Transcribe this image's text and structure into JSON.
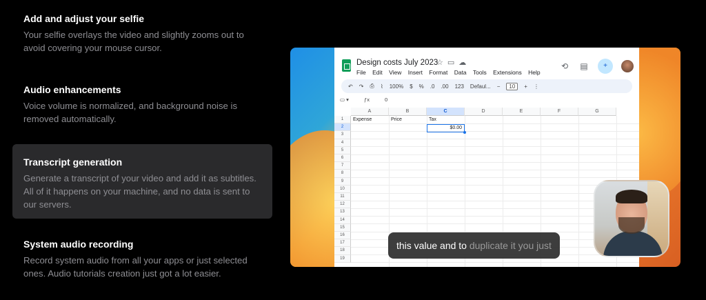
{
  "features": [
    {
      "title": "Add and adjust your selfie",
      "description": "Your selfie overlays the video and slightly zooms out to avoid covering your mouse cursor."
    },
    {
      "title": "Audio enhancements",
      "description": "Voice volume is normalized, and background noise is removed automatically."
    },
    {
      "title": "Transcript generation",
      "description": "Generate a transcript of your video and add it as subtitles. All of it happens on your machine, and no data is sent to our servers."
    },
    {
      "title": "System audio recording",
      "description": "Record system audio from all your apps or just selected ones. Audio tutorials creation just got a lot easier."
    }
  ],
  "sheets": {
    "title": "Design costs July 2023",
    "menu": [
      "File",
      "Edit",
      "View",
      "Insert",
      "Format",
      "Data",
      "Tools",
      "Extensions",
      "Help"
    ],
    "toolbar": {
      "zoom": "100%",
      "currency": "$",
      "percent": "%",
      "dec_less": ".0",
      "dec_more": ".00",
      "number_format": "123",
      "font": "Defaul...",
      "font_size": "10"
    },
    "formula_bar": {
      "value": "0"
    },
    "columns": [
      "A",
      "B",
      "C",
      "D",
      "E",
      "F",
      "G"
    ],
    "rows": [
      "1",
      "2",
      "3",
      "4",
      "5",
      "6",
      "7",
      "8",
      "9",
      "10",
      "11",
      "12",
      "13",
      "14",
      "15",
      "16",
      "17",
      "18",
      "19"
    ],
    "headers": {
      "a1": "Expense",
      "b1": "Price",
      "c1": "Tax"
    },
    "selected_cell_value": "$0.00"
  },
  "caption": {
    "spoken": "this value and to ",
    "upcoming": "duplicate it you just"
  },
  "icons": {
    "history": "history-icon",
    "comments": "comment-icon",
    "share": "share-icon",
    "avatar": "avatar"
  },
  "colors": {
    "accent": "#1a73e8",
    "sheets_green": "#0f9d58",
    "active_panel": "#2a2a2c"
  }
}
